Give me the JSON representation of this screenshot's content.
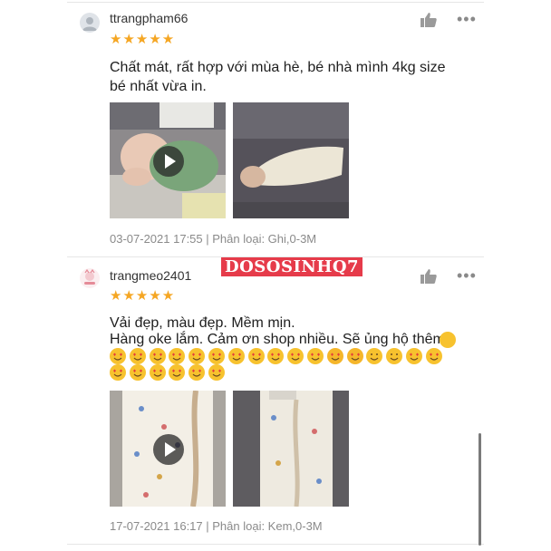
{
  "reviews": [
    {
      "username": "ttrangpham66",
      "stars": "★★★★★",
      "text": "Chất mát, rất hợp với mùa hè, bé nhà mình 4kg size bé nhất vừa in.",
      "meta": "03-07-2021 17:55 | Phân loại: Ghi,0-3M",
      "images": [
        {
          "kind": "video",
          "description_icon": "play-icon"
        },
        {
          "kind": "photo"
        }
      ]
    },
    {
      "username": "trangmeo2401",
      "stars": "★★★★★",
      "text_line1": "Vải đẹp, màu đẹp. Mềm mịn.",
      "text_line2": "Hàng oke lắm. Cảm ơn shop nhiều. Sẽ ủng hộ thêm",
      "emoji_row1": [
        "heart-eyes",
        "heart-eyes",
        "heart-eyes",
        "heart-eyes",
        "heart-eyes",
        "heart-eyes",
        "heart-eyes",
        "heart-eyes",
        "heart-eyes",
        "heart-eyes",
        "heart-eyes",
        "smiling-hearts",
        "smiling-hearts",
        "kissing",
        "blush",
        "heart-eyes",
        "heart-eyes"
      ],
      "emoji_row2": [
        "heart-eyes",
        "heart-eyes",
        "heart-eyes",
        "heart-eyes",
        "heart-eyes",
        "heart-eyes"
      ],
      "meta": "17-07-2021 16:17 | Phân loại: Kem,0-3M",
      "images": [
        {
          "kind": "video",
          "description_icon": "play-icon"
        },
        {
          "kind": "photo"
        }
      ]
    }
  ],
  "watermark": "DOSOSINHQ7",
  "icons": {
    "like": "thumbs-up-icon",
    "more": "more-icon"
  },
  "colors": {
    "star": "#f5a623",
    "watermark_bg": "#e63b4a",
    "meta": "#8a8a8a"
  }
}
